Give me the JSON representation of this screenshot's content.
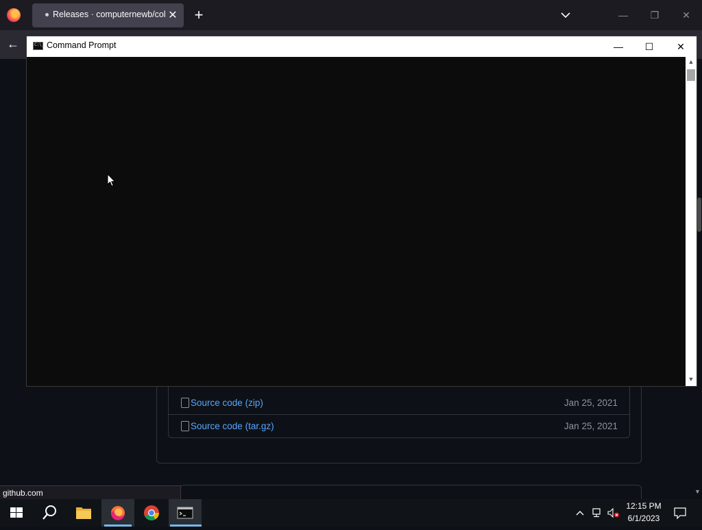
{
  "browser": {
    "tab_title": "Releases · computernewb/collab-vm-web-app",
    "tab_close": "✕",
    "new_tab": "+",
    "back": "←"
  },
  "page": {
    "assets": [
      {
        "name": "Source code",
        "ext": "(zip)",
        "date": "Jan 25, 2021"
      },
      {
        "name": "Source code",
        "ext": "(tar.gz)",
        "date": "Jan 25, 2021"
      }
    ]
  },
  "status_bar": {
    "url": "github.com"
  },
  "cmd": {
    "title": "Command Prompt",
    "icon_text": "C:\\_",
    "minimize": "—",
    "maximize": "☐",
    "close": "✕"
  },
  "taskbar": {
    "time": "12:15 PM",
    "date": "6/1/2023",
    "apps": [
      "start-icon",
      "search-icon",
      "file-explorer-icon",
      "firefox-icon",
      "chrome-icon",
      "command-prompt-icon"
    ]
  },
  "colors": {
    "link": "#58a6ff",
    "page_bg": "#0d1117",
    "console_bg": "#0c0c0c",
    "taskbar_accent": "#76b9ed"
  }
}
